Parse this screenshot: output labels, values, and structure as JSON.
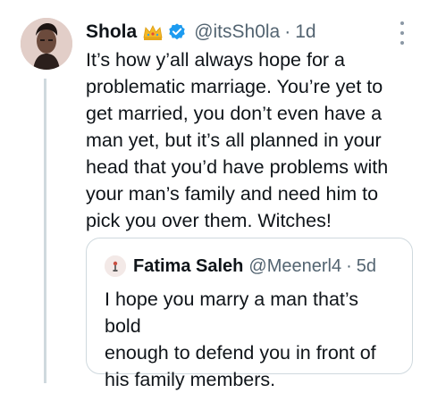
{
  "tweet": {
    "author": {
      "name": "Shola",
      "handle": "@itsSh0la",
      "avatar_icon": "profile-photo",
      "badges": [
        "crown-emoji",
        "verified-badge"
      ]
    },
    "separator": "·",
    "time": "1d",
    "text": "It’s how y’all always hope for a\nproblematic marriage. You’re yet to\nget married, you don’t even have a\nman yet, but it’s all planned in your\nhead that you’d have problems with\nyour man’s family and need him to\npick you over them. Witches!"
  },
  "quote": {
    "author": {
      "name": "Fatima Saleh",
      "handle": "@Meenerl4",
      "avatar_icon": "profile-photo"
    },
    "separator": "·",
    "time": "5d",
    "text": "I hope you marry a man that’s bold\nenough to defend you in front of\nhis family members."
  },
  "colors": {
    "text_primary": "#0f1419",
    "text_secondary": "#536471",
    "verified_blue": "#1d9bf0",
    "border": "#cfd9de"
  }
}
